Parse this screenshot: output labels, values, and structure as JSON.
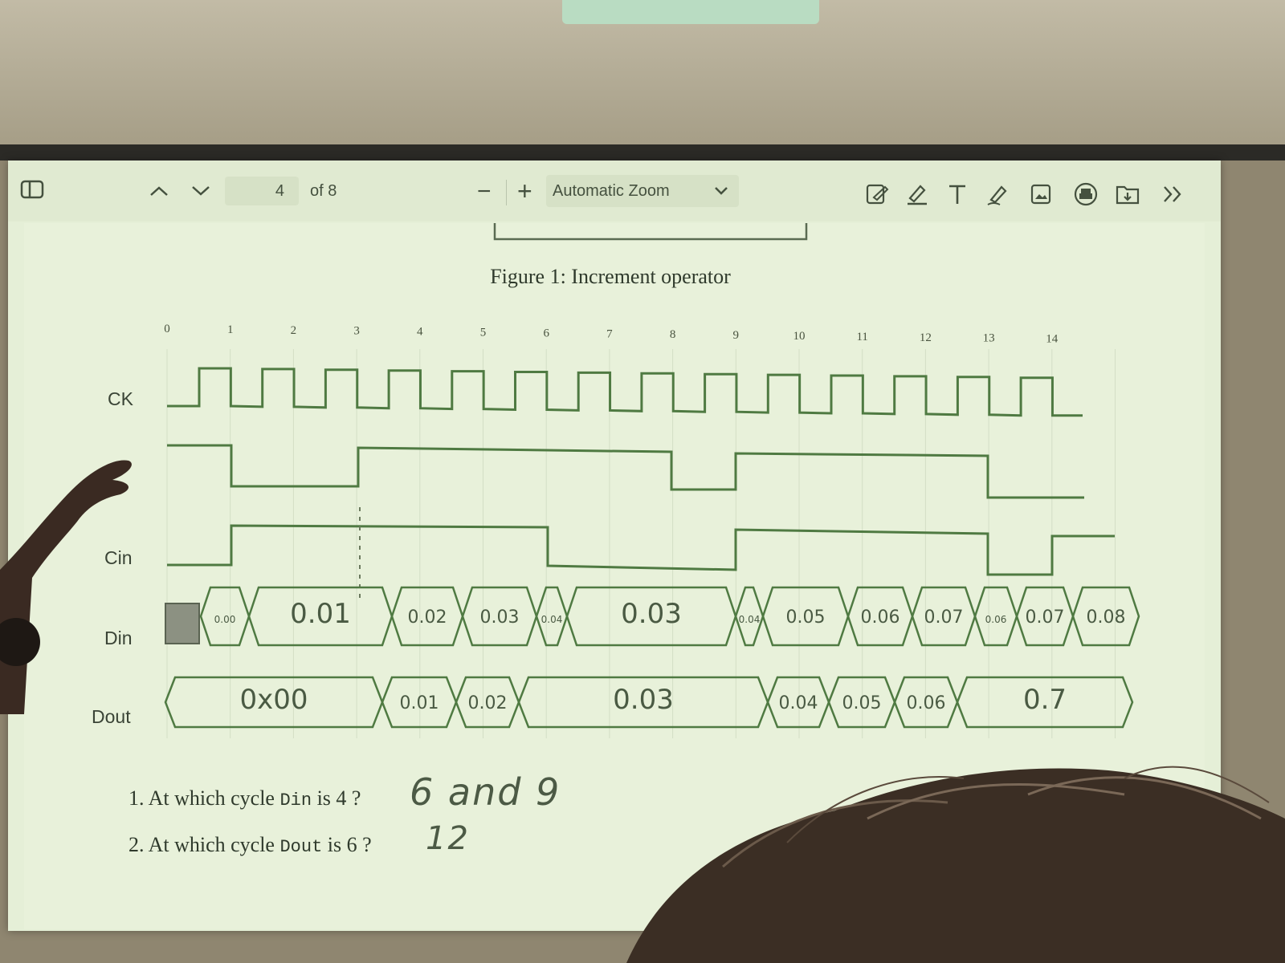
{
  "toolbar": {
    "sidebar_icon": "sidebar-toggle-icon",
    "prev_icon": "chevron-up-icon",
    "next_icon": "chevron-down-icon",
    "page_number": "4",
    "page_total": "of 8",
    "zoom_out": "−",
    "zoom_in": "+",
    "zoom_value": "Automatic Zoom",
    "tool_icons": [
      "add-text-icon",
      "highlight-icon",
      "text-icon",
      "draw-icon",
      "image-icon",
      "print-icon",
      "save-icon",
      "more-tools-icon"
    ]
  },
  "figure": {
    "caption": "Figure 1: Increment operator",
    "cycle_labels": [
      "0",
      "1",
      "2",
      "3",
      "4",
      "5",
      "6",
      "7",
      "8",
      "9",
      "10",
      "11",
      "12",
      "13",
      "14"
    ],
    "signals": [
      "CK",
      "Cin",
      "Din",
      "Dout"
    ]
  },
  "din_values": [
    "0.00",
    "0.01",
    "0.02",
    "0.03",
    "0.04",
    "0.03",
    "0.04",
    "0.05",
    "0.06",
    "0.07",
    "0.06",
    "0.07",
    "0.08"
  ],
  "dout_values": [
    "0x00",
    "0.01",
    "0.02",
    "0.03",
    "0.04",
    "0.05",
    "0.06",
    "0.7"
  ],
  "questions": [
    {
      "number": "1.",
      "before": "At which cycle",
      "code": "Din",
      "after": "is 4 ?",
      "answer": "6 and 9"
    },
    {
      "number": "2.",
      "before": "At which cycle",
      "code": "Dout",
      "after": "is 6 ?",
      "answer": "12"
    }
  ],
  "colors": {
    "screen": "#e5efd7",
    "waveform": "#5b7a4c",
    "text": "#2f3a2c"
  }
}
